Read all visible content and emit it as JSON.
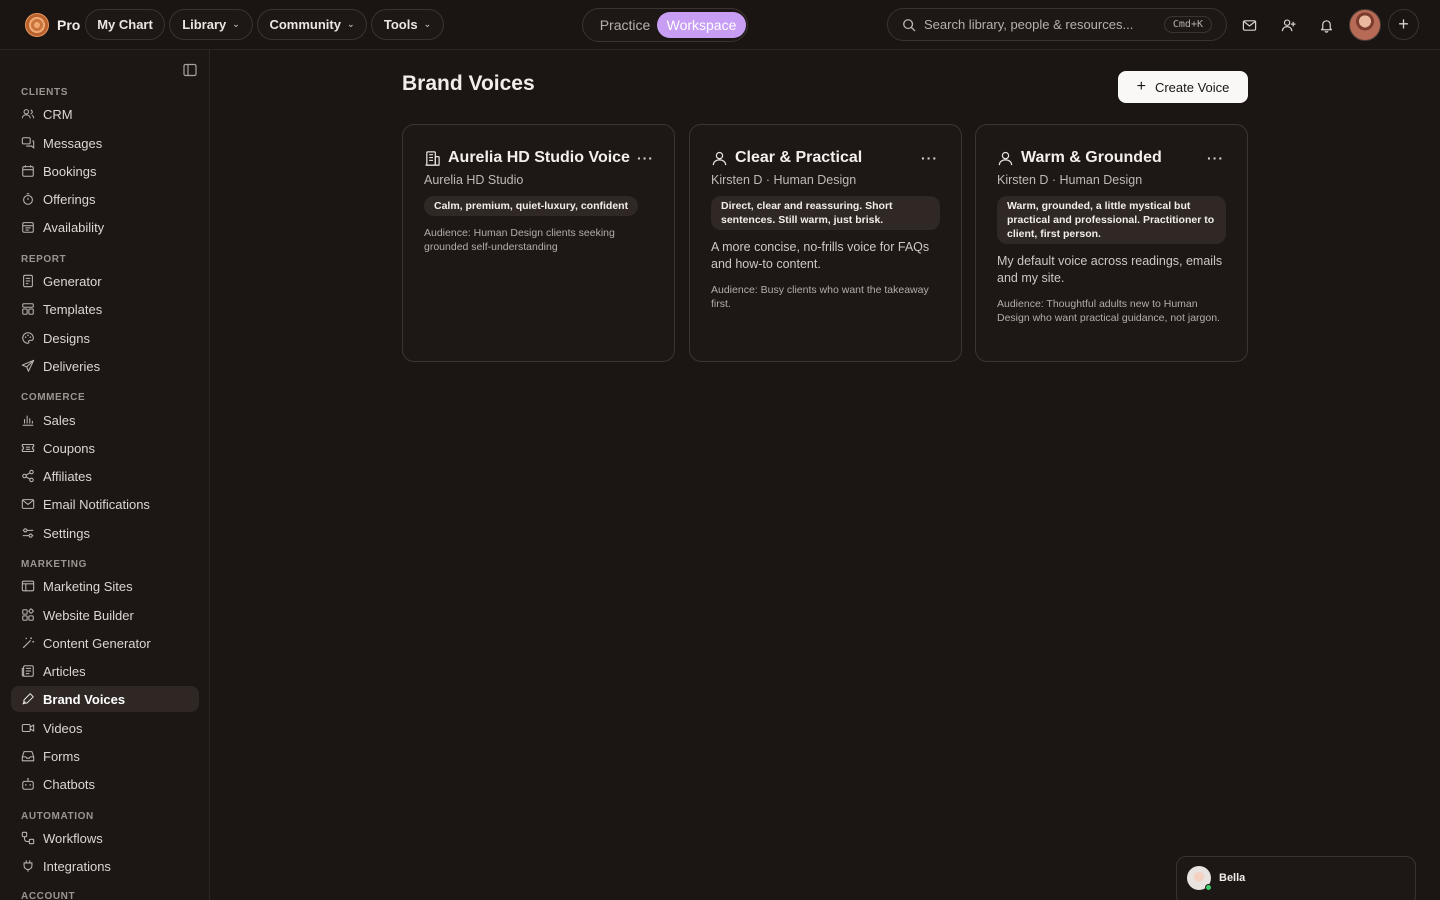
{
  "brand": {
    "name": "Pro"
  },
  "topnav": {
    "my_chart": "My Chart",
    "library": "Library",
    "community": "Community",
    "tools": "Tools"
  },
  "mode_toggle": {
    "practice": "Practice",
    "workspace": "Workspace",
    "active": "Workspace"
  },
  "search": {
    "placeholder": "Search library, people & resources...",
    "shortcut": "Cmd+K"
  },
  "sidebar": {
    "sections": [
      {
        "title": "CLIENTS",
        "items": [
          "CRM",
          "Messages",
          "Bookings",
          "Offerings",
          "Availability"
        ]
      },
      {
        "title": "REPORT",
        "items": [
          "Generator",
          "Templates",
          "Designs",
          "Deliveries"
        ]
      },
      {
        "title": "COMMERCE",
        "items": [
          "Sales",
          "Coupons",
          "Affiliates",
          "Email Notifications",
          "Settings"
        ]
      },
      {
        "title": "MARKETING",
        "items": [
          "Marketing Sites",
          "Website Builder",
          "Content Generator",
          "Articles",
          "Brand Voices",
          "Videos",
          "Forms",
          "Chatbots"
        ]
      },
      {
        "title": "AUTOMATION",
        "items": [
          "Workflows",
          "Integrations"
        ]
      },
      {
        "title": "ACCOUNT",
        "items": []
      }
    ],
    "active_item": "Brand Voices"
  },
  "main": {
    "title": "Brand Voices",
    "create_label": "Create Voice",
    "voices": [
      {
        "title": "Aurelia HD Studio Voice",
        "subtitle": "Aurelia HD Studio",
        "tone": "Calm, premium, quiet-luxury, confident",
        "description": "",
        "audience": "Audience: Human Design clients seeking grounded self-understanding",
        "icon": "building-icon"
      },
      {
        "title": "Clear & Practical",
        "subtitle": "Kirsten D · Human Design",
        "tone": "Direct, clear and reassuring. Short sentences. Still warm, just brisk.",
        "description": "A more concise, no-frills voice for FAQs and how-to content.",
        "audience": "Audience: Busy clients who want the takeaway first.",
        "icon": "user-icon"
      },
      {
        "title": "Warm & Grounded",
        "subtitle": "Kirsten D · Human Design",
        "tone": "Warm, grounded, a little mystical but practical and professional. Practitioner to client, first person.",
        "description": "My default voice across readings, emails and my site.",
        "audience": "Audience: Thoughtful adults new to Human Design who want practical guidance, not jargon.",
        "icon": "user-icon"
      }
    ]
  },
  "chat": {
    "name": "Bella"
  },
  "colors": {
    "background": "#1b1614",
    "accent": "#c79ef4",
    "online": "#3ccf6a"
  }
}
